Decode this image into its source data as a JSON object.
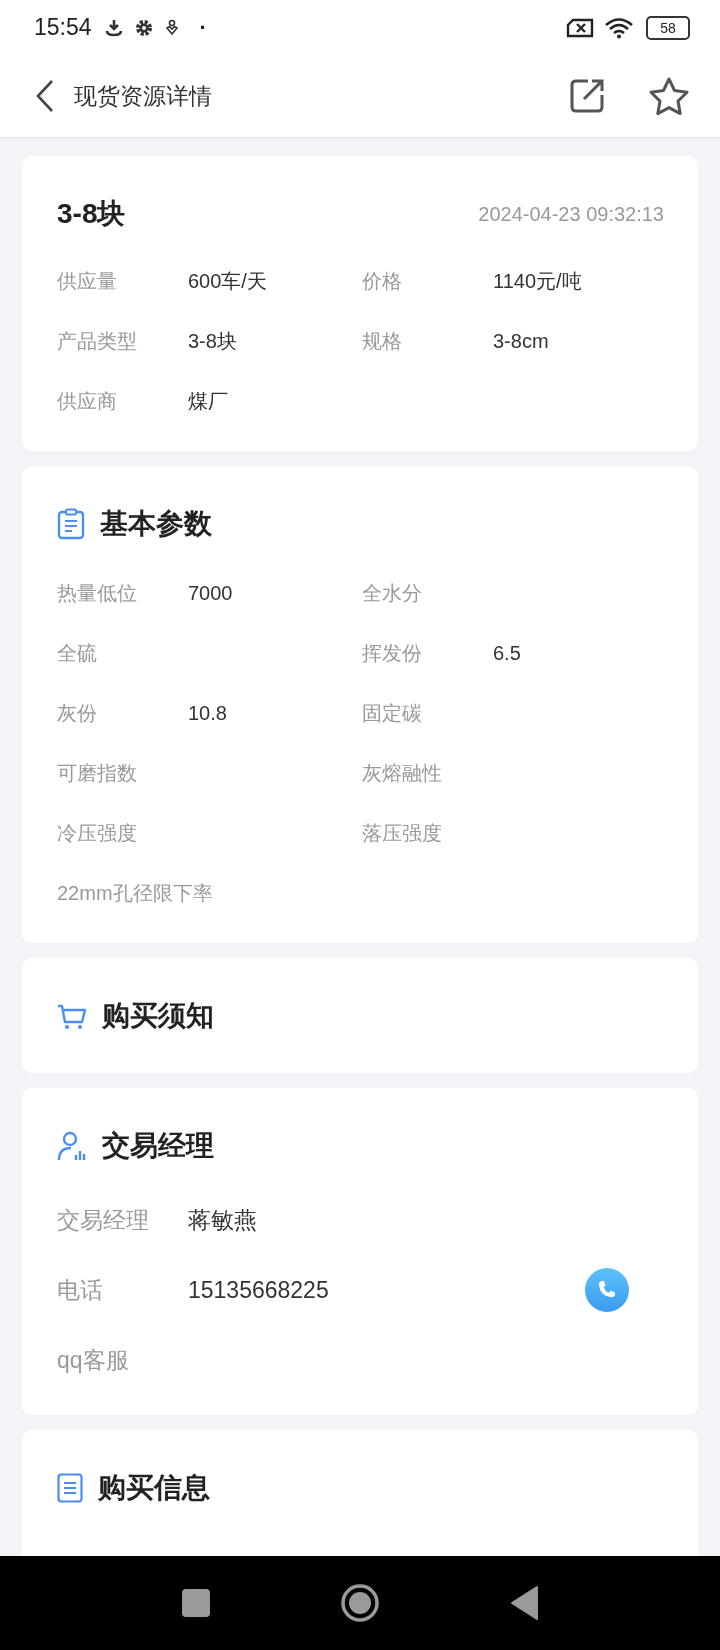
{
  "status_bar": {
    "time": "15:54",
    "dot": "·",
    "battery": "58"
  },
  "header": {
    "title": "现货资源详情"
  },
  "summary": {
    "title": "3-8块",
    "date": "2024-04-23 09:32:13",
    "fields": [
      {
        "label": "供应量",
        "value": "600车/天"
      },
      {
        "label": "价格",
        "value": "1140元/吨"
      },
      {
        "label": "产品类型",
        "value": "3-8块"
      },
      {
        "label": "规格",
        "value": "3-8cm"
      },
      {
        "label": "供应商",
        "value": "煤厂"
      }
    ]
  },
  "params": {
    "title": "基本参数",
    "fields": [
      {
        "label": "热量低位",
        "value": "7000"
      },
      {
        "label": "全水分"
      },
      {
        "label": "全硫"
      },
      {
        "label": "挥发份",
        "value": "6.5"
      },
      {
        "label": "灰份",
        "value": "10.8"
      },
      {
        "label": "固定碳"
      },
      {
        "label": "可磨指数"
      },
      {
        "label": "灰熔融性"
      },
      {
        "label": "冷压强度"
      },
      {
        "label": "落压强度"
      },
      {
        "label": "22mm孔径限下率"
      }
    ]
  },
  "notice": {
    "title": "购买须知"
  },
  "manager": {
    "title": "交易经理",
    "rows": [
      {
        "label": "交易经理",
        "value": "蒋敏燕",
        "kind": "text"
      },
      {
        "label": "电话",
        "value": "15135668225",
        "kind": "phone"
      },
      {
        "label": "qq客服",
        "kind": "text"
      }
    ]
  },
  "purchase": {
    "title": "购买信息"
  }
}
